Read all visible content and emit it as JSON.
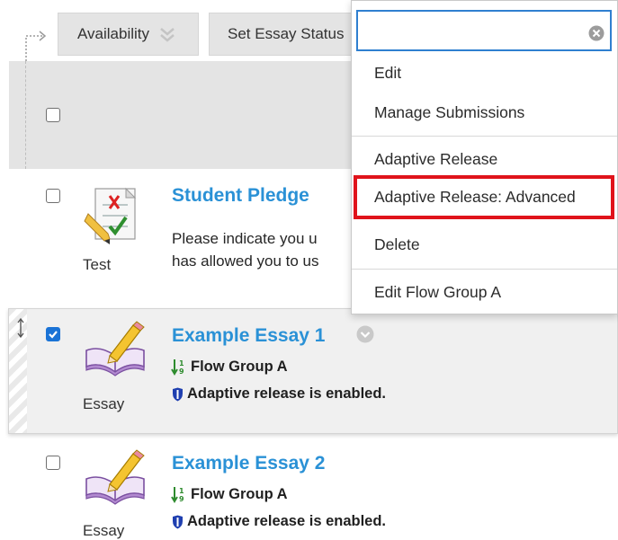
{
  "toolbar": {
    "availability_label": "Availability",
    "set_essay_status_label": "Set Essay Status"
  },
  "items": [
    {
      "title": "Student Pledge",
      "type": "Test",
      "body_lines": [
        "Please indicate you u",
        "has allowed you to us"
      ],
      "checked": false
    },
    {
      "title": "Example Essay 1",
      "type": "Essay",
      "flow_group": "Flow Group A",
      "adaptive": "Adaptive release is enabled.",
      "checked": true
    },
    {
      "title": "Example Essay 2",
      "type": "Essay",
      "flow_group": "Flow Group A",
      "adaptive": "Adaptive release is enabled.",
      "checked": false
    }
  ],
  "menu": {
    "search_value": "",
    "items": [
      "Edit",
      "Manage Submissions",
      "Adaptive Release",
      "Adaptive Release: Advanced",
      "Delete",
      "Edit Flow Group A"
    ],
    "highlighted": "Adaptive Release: Advanced"
  },
  "colors": {
    "link_blue": "#2a91d6",
    "checkbox_blue": "#1a73d6",
    "highlight_red": "#e0131b",
    "search_border": "#2f7fd0"
  },
  "icons": [
    "connector-arrow-icon",
    "chevron-down-icon",
    "clear-icon",
    "test-icon",
    "essay-icon",
    "options-chevron-icon",
    "reorder-icon",
    "sort-numeric-icon",
    "shield-icon"
  ]
}
